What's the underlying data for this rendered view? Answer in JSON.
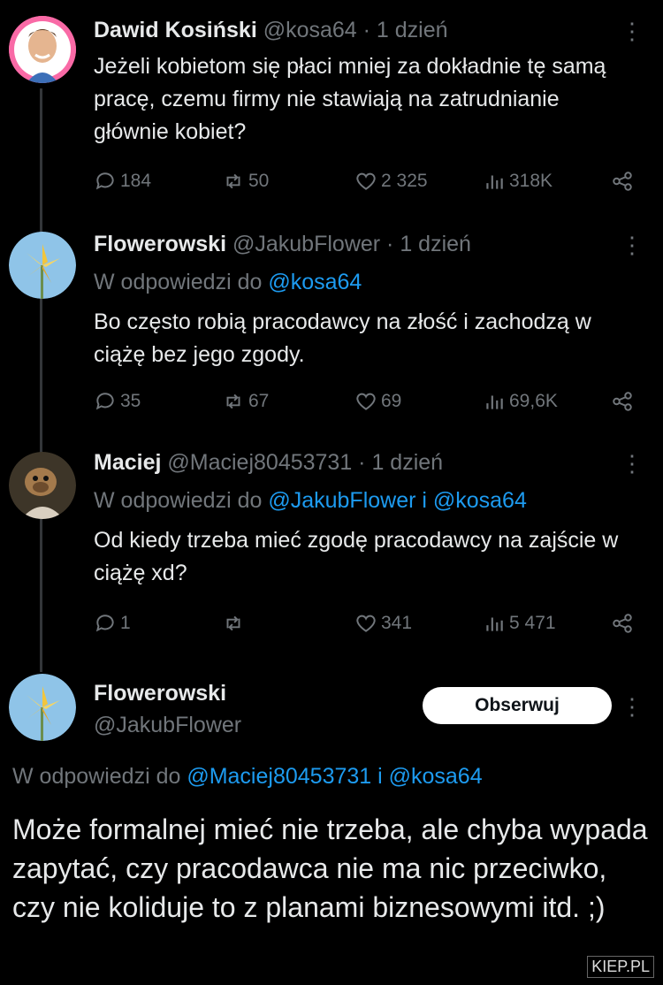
{
  "tweets": [
    {
      "name": "Dawid Kosiński",
      "meta": "@kosa64 · 1 dzień",
      "text": "Jeżeli kobietom się płaci mniej za dokładnie tę samą pracę, czemu firmy nie stawiają na zatrudnianie głównie kobiet?",
      "reply_prefix": "",
      "reply_targets": "",
      "replies": "184",
      "retweets": "50",
      "likes": "2 325",
      "views": "318K"
    },
    {
      "name": "Flowerowski",
      "meta": "@JakubFlower · 1 dzień",
      "reply_prefix": "W odpowiedzi do ",
      "reply_targets": "@kosa64",
      "text": "Bo często robią pracodawcy na złość i zachodzą w ciążę bez jego zgody.",
      "replies": "35",
      "retweets": "67",
      "likes": "69",
      "views": "69,6K"
    },
    {
      "name": "Maciej",
      "meta": "@Maciej80453731 · 1 dzień",
      "reply_prefix": "W odpowiedzi do ",
      "reply_targets": "@JakubFlower i @kosa64",
      "text": "Od kiedy trzeba mieć zgodę pracodawcy na zajście w ciążę xd?",
      "replies": "1",
      "retweets": "",
      "likes": "341",
      "views": "5 471"
    }
  ],
  "focused": {
    "name": "Flowerowski",
    "handle": "@JakubFlower",
    "follow_label": "Obserwuj",
    "reply_prefix": "W odpowiedzi do ",
    "reply_targets": "@Maciej80453731 i @kosa64",
    "text": "Może formalnej mieć nie trzeba, ale chyba wypada zapytać, czy pracodawca nie ma nic przeciwko, czy nie koliduje to z planami biznesowymi itd. ;)"
  },
  "watermark": "KIEP.PL",
  "colors": {
    "background": "#000000",
    "link": "#1d9bf0",
    "muted": "#71767b",
    "text": "#e7e9ea"
  }
}
